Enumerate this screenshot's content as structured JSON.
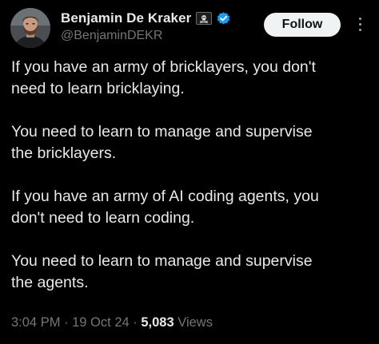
{
  "author": {
    "display_name": "Benjamin De Kraker",
    "handle": "@BenjaminDEKR",
    "avatar_icon": "avatar-photo",
    "badge_icon": "pirate-flag-icon",
    "verified_icon": "verified-badge-icon",
    "verified_color": "#1d9bf0"
  },
  "actions": {
    "follow_label": "Follow",
    "more_icon": "more-vertical-icon"
  },
  "tweet": {
    "paragraphs": [
      "If you have an army of bricklayers, you don't\nneed to learn bricklaying.",
      "You need to learn to manage and supervise\nthe bricklayers.",
      "If you have an army of AI coding agents, you\ndon't need to learn coding.",
      "You need to learn to manage and supervise\nthe agents."
    ]
  },
  "meta": {
    "time": "3:04 PM",
    "separator": " · ",
    "date": "19 Oct 24",
    "views_count": "5,083",
    "views_label": "Views"
  },
  "colors": {
    "background": "#000000",
    "text_primary": "#e7e9ea",
    "text_secondary": "#71767b",
    "button_bg": "#eff3f4",
    "button_text": "#0f1419"
  }
}
